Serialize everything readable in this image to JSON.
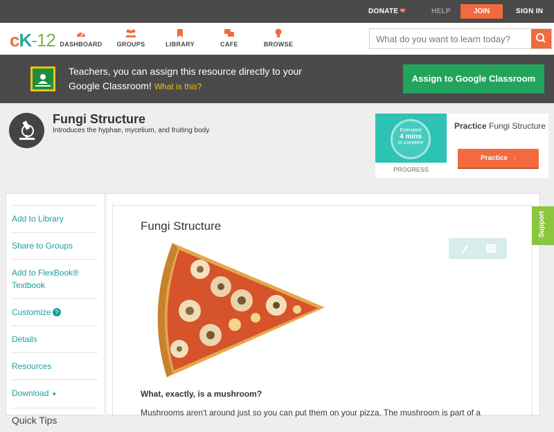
{
  "topbar": {
    "donate": "DONATE",
    "help": "HELP",
    "join": "JOIN",
    "signin": "SIGN IN"
  },
  "logo": {
    "c": "c",
    "k": "K",
    "dash": "-",
    "n": "12"
  },
  "nav": {
    "dashboard": "DASHBOARD",
    "groups": "GROUPS",
    "library": "LIBRARY",
    "cafe": "CAFE",
    "browse": "BROWSE"
  },
  "search": {
    "placeholder": "What do you want to learn today?"
  },
  "banner": {
    "text": "Teachers, you can assign this resource directly to your Google Classroom!",
    "what": "What is this?",
    "assign": "Assign to Google Classroom"
  },
  "concept": {
    "title": "Fungi Structure",
    "description": "Introduces the hyphae, mycelium, and fruiting body."
  },
  "practice": {
    "estimated": "Estimated",
    "mins": "4 mins",
    "to_complete": "to complete",
    "progress": "PROGRESS",
    "heading_bold": "Practice",
    "heading_rest": "Fungi Structure",
    "button": "Practice"
  },
  "sidebar": {
    "add_library": "Add to Library",
    "share_groups": "Share to Groups",
    "add_flexbook": "Add to FlexBook® Textbook",
    "customize": "Customize",
    "details": "Details",
    "resources": "Resources",
    "download": "Download",
    "quick_tips": "Quick Tips"
  },
  "article": {
    "title": "Fungi Structure",
    "question": "What, exactly, is a mushroom?",
    "paragraph": "Mushrooms aren't around just so you can put them on your pizza. The mushroom is part of a"
  },
  "support": "Support",
  "colors": {
    "accent": "#f26a3d",
    "teal": "#1a9f9a",
    "green": "#22a45d",
    "support": "#8cc63f"
  }
}
